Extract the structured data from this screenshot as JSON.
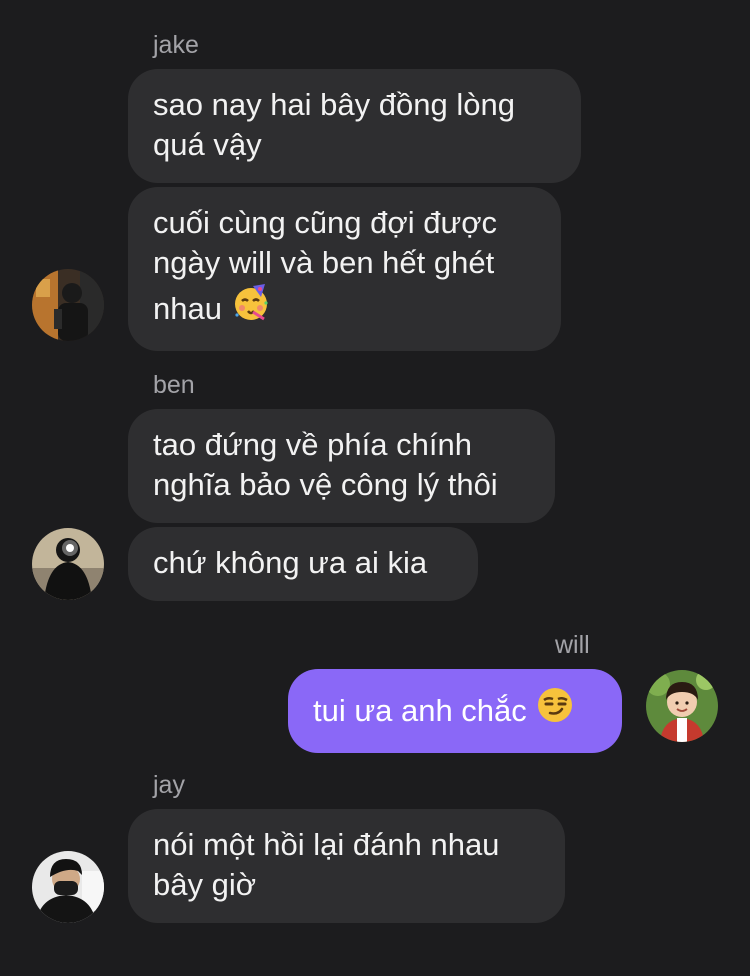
{
  "messages": {
    "jake": {
      "name": "jake",
      "msg1": "sao nay hai bây đồng lòng quá vậy",
      "msg2": "cuối cùng cũng đợi được ngày will và ben hết ghét nhau",
      "msg2_emoji": "🥳"
    },
    "ben": {
      "name": "ben",
      "msg1": "tao đứng về phía chính nghĩa bảo vệ công lý thôi",
      "msg2": "chứ không ưa ai kia"
    },
    "will": {
      "name": "will",
      "msg1": "tui ưa anh chắc",
      "msg1_emoji": "😏"
    },
    "jay": {
      "name": "jay",
      "msg1": "nói một hồi lại đánh nhau bây giờ"
    }
  },
  "colors": {
    "background": "#1c1c1e",
    "incoming_bubble": "#2e2e30",
    "outgoing_bubble": "#8a68f7",
    "sender_name": "#a3a3a8",
    "text": "#f2f2f2"
  },
  "icons": {
    "party_emoji": "partying-face-icon",
    "smirk_emoji": "smirking-face-icon"
  }
}
